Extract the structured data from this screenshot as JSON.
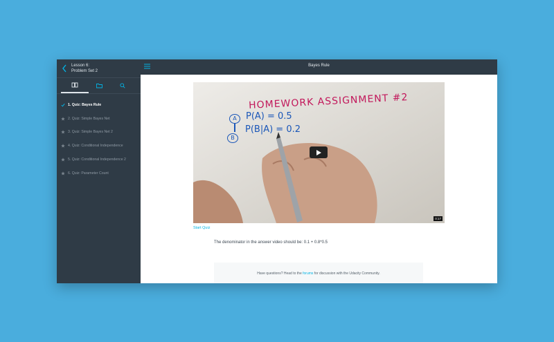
{
  "sidebar": {
    "lesson_line1": "Lesson 6:",
    "lesson_line2": "Problem Set 2",
    "tabs": [
      "book-icon",
      "folder-icon",
      "search-icon"
    ],
    "items": [
      {
        "label": "1. Quiz: Bayes Rule",
        "status": "complete"
      },
      {
        "label": "2. Quiz: Simple Bayes Net",
        "status": "star"
      },
      {
        "label": "3. Quiz: Simple Bayes Net 2",
        "status": "star"
      },
      {
        "label": "4. Quiz: Conditional Independence",
        "status": "star"
      },
      {
        "label": "5. Quiz: Conditional Independence 2",
        "status": "star"
      },
      {
        "label": "6. Quiz: Parameter Count",
        "status": "star"
      }
    ]
  },
  "header": {
    "title": "Bayes Rule"
  },
  "video": {
    "whiteboard_title": "HOMEWORK ASSIGNMENT #2",
    "eq1": "P(A) = 0.5",
    "eq2": "P(B|A) = 0.2",
    "node_a": "A",
    "node_b": "B",
    "duration": "0:17"
  },
  "main": {
    "start_quiz": "Start Quiz",
    "note": "The denominator in the answer video should be: 0.1 + 0.8*0.5",
    "help_prefix": "Have questions? Head to the",
    "help_link": "forums",
    "help_suffix": "for discussion with the Udacity Community."
  },
  "colors": {
    "background": "#4aaddd",
    "sidebar": "#2f3b46",
    "accent": "#02b3e4"
  }
}
